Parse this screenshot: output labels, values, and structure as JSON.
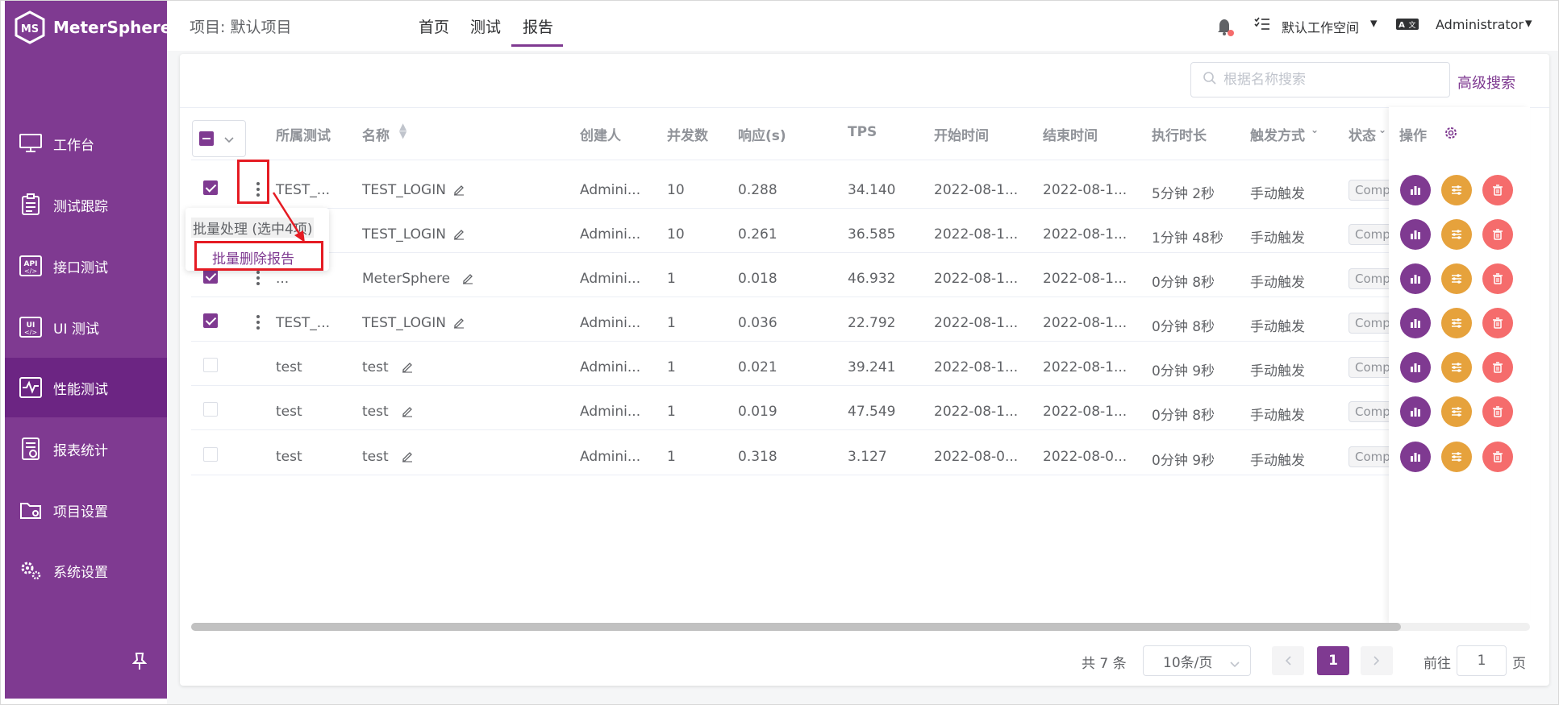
{
  "brand": {
    "name": "MeterSphere"
  },
  "sidebar": {
    "items": [
      {
        "label": "工作台",
        "icon": "monitor-icon"
      },
      {
        "label": "测试跟踪",
        "icon": "clipboard-icon"
      },
      {
        "label": "接口测试",
        "icon": "api-icon"
      },
      {
        "label": "UI 测试",
        "icon": "ui-icon"
      },
      {
        "label": "性能测试",
        "icon": "performance-icon"
      },
      {
        "label": "报表统计",
        "icon": "report-icon"
      },
      {
        "label": "项目设置",
        "icon": "folder-icon"
      },
      {
        "label": "系统设置",
        "icon": "gears-icon"
      }
    ],
    "active_index": 4
  },
  "header": {
    "project": "项目: 默认项目",
    "tabs": [
      "首页",
      "测试",
      "报告"
    ],
    "active_tab": "报告",
    "workspace": "默认工作空间",
    "user": "Administrator"
  },
  "toolbar": {
    "search_placeholder": "根据名称搜索",
    "advanced_search": "高级搜索"
  },
  "table": {
    "columns": [
      "所属测试",
      "名称",
      "创建人",
      "并发数",
      "响应(s)",
      "TPS",
      "开始时间",
      "结束时间",
      "执行时长",
      "触发方式",
      "状态",
      "操作"
    ],
    "rows": [
      {
        "checked": true,
        "test": "TEST_...",
        "name": "TEST_LOGIN",
        "creator": "Admini...",
        "concurrency": "10",
        "response": "0.288",
        "tps": "34.140",
        "start": "2022-08-1...",
        "end": "2022-08-1...",
        "duration": "5分钟 2秒",
        "trigger": "手动触发",
        "status": "Comp"
      },
      {
        "checked": true,
        "test": "...",
        "name": "TEST_LOGIN",
        "creator": "Admini...",
        "concurrency": "10",
        "response": "0.261",
        "tps": "36.585",
        "start": "2022-08-1...",
        "end": "2022-08-1...",
        "duration": "1分钟 48秒",
        "trigger": "手动触发",
        "status": "Comp"
      },
      {
        "checked": true,
        "test": "...",
        "name": "MeterSphere",
        "creator": "Admini...",
        "concurrency": "1",
        "response": "0.018",
        "tps": "46.932",
        "start": "2022-08-1...",
        "end": "2022-08-1...",
        "duration": "0分钟 8秒",
        "trigger": "手动触发",
        "status": "Comp"
      },
      {
        "checked": true,
        "test": "TEST_...",
        "name": "TEST_LOGIN",
        "creator": "Admini...",
        "concurrency": "1",
        "response": "0.036",
        "tps": "22.792",
        "start": "2022-08-1...",
        "end": "2022-08-1...",
        "duration": "0分钟 8秒",
        "trigger": "手动触发",
        "status": "Comp"
      },
      {
        "checked": false,
        "test": "test",
        "name": "test",
        "creator": "Admini...",
        "concurrency": "1",
        "response": "0.021",
        "tps": "39.241",
        "start": "2022-08-1...",
        "end": "2022-08-1...",
        "duration": "0分钟 9秒",
        "trigger": "手动触发",
        "status": "Comp"
      },
      {
        "checked": false,
        "test": "test",
        "name": "test",
        "creator": "Admini...",
        "concurrency": "1",
        "response": "0.019",
        "tps": "47.549",
        "start": "2022-08-1...",
        "end": "2022-08-1...",
        "duration": "0分钟 8秒",
        "trigger": "手动触发",
        "status": "Comp"
      },
      {
        "checked": false,
        "test": "test",
        "name": "test",
        "creator": "Admini...",
        "concurrency": "1",
        "response": "0.318",
        "tps": "3.127",
        "start": "2022-08-0...",
        "end": "2022-08-0...",
        "duration": "0分钟 9秒",
        "trigger": "手动触发",
        "status": "Comp"
      }
    ]
  },
  "batch_menu": {
    "title": "批量处理 (选中4项)",
    "delete": "批量删除报告"
  },
  "pagination": {
    "total": "共 7 条",
    "page_size": "10条/页",
    "current": "1",
    "goto_label": "前往",
    "goto_value": "1",
    "page_suffix": "页"
  },
  "colors": {
    "brand": "#7f3a91",
    "sidebar_active": "#6c2583",
    "op_report": "#7f3a91",
    "op_adjust": "#e6a23c",
    "op_delete": "#f56c6c",
    "annotation": "#e51b23"
  }
}
